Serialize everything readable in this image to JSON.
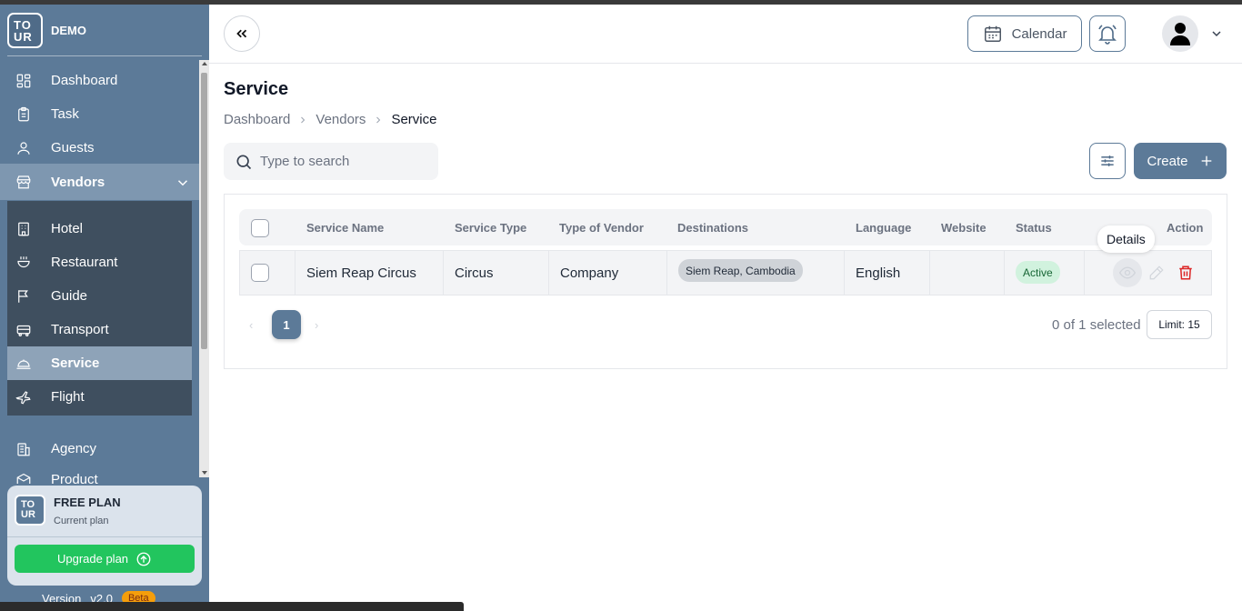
{
  "brand": {
    "logo_top": "TO",
    "logo_bottom": "UR",
    "name": "DEMO"
  },
  "sidebar": {
    "items": [
      {
        "label": "Dashboard",
        "icon": "dashboard-icon"
      },
      {
        "label": "Task",
        "icon": "clipboard-icon"
      },
      {
        "label": "Guests",
        "icon": "user-icon"
      }
    ],
    "vendors": {
      "label": "Vendors",
      "icon": "store-icon",
      "expanded": true
    },
    "vendor_items": [
      {
        "label": "Hotel",
        "icon": "building-icon"
      },
      {
        "label": "Restaurant",
        "icon": "restaurant-icon"
      },
      {
        "label": "Guide",
        "icon": "flag-icon"
      },
      {
        "label": "Transport",
        "icon": "bus-icon"
      },
      {
        "label": "Service",
        "icon": "service-icon",
        "active": true
      },
      {
        "label": "Flight",
        "icon": "plane-icon"
      }
    ],
    "more_items": [
      {
        "label": "Agency",
        "icon": "agency-icon"
      },
      {
        "label": "Product",
        "icon": "product-icon"
      }
    ],
    "plan": {
      "title": "FREE PLAN",
      "subtitle": "Current plan",
      "upgrade_label": "Upgrade plan"
    },
    "version": {
      "label": "Version",
      "number": "v2.0",
      "badge": "Beta"
    }
  },
  "header": {
    "calendar_label": "Calendar"
  },
  "page": {
    "title": "Service",
    "breadcrumb": [
      "Dashboard",
      "Vendors",
      "Service"
    ],
    "search_placeholder": "Type to search",
    "create_label": "Create"
  },
  "table": {
    "columns": [
      "Service Name",
      "Service Type",
      "Type of Vendor",
      "Destinations",
      "Language",
      "Website",
      "Status",
      "Action"
    ],
    "rows": [
      {
        "service_name": "Siem Reap Circus",
        "service_type": "Circus",
        "vendor_type": "Company",
        "destination": "Siem Reap, Cambodia",
        "language": "English",
        "website": "",
        "status": "Active"
      }
    ],
    "tooltip": "Details"
  },
  "pagination": {
    "current_page": "1",
    "selected_text": "0 of 1 selected",
    "limit_label": "Limit: 15"
  },
  "colors": {
    "primary": "#5c7a98",
    "success": "#22c55e",
    "danger": "#dc2626"
  }
}
